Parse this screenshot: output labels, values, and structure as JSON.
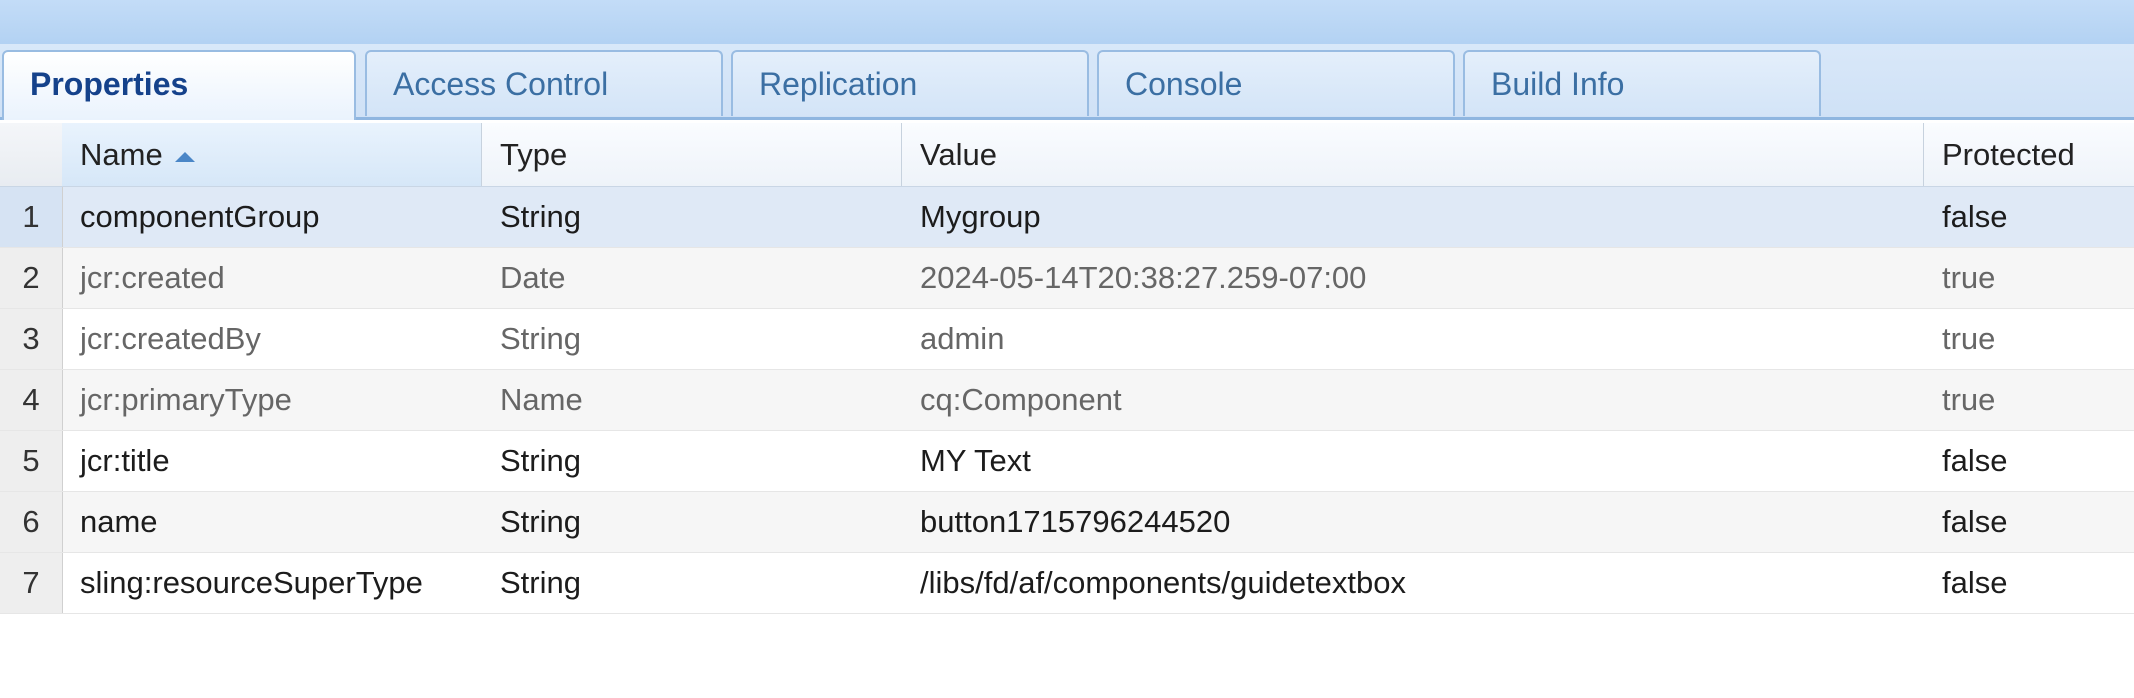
{
  "tabs": [
    {
      "label": "Properties",
      "active": true
    },
    {
      "label": "Access Control",
      "active": false
    },
    {
      "label": "Replication",
      "active": false
    },
    {
      "label": "Console",
      "active": false
    },
    {
      "label": "Build Info",
      "active": false
    }
  ],
  "table": {
    "columns": [
      "Name",
      "Type",
      "Value",
      "Protected"
    ],
    "sorted_column": "Name",
    "sort_direction": "ascending",
    "rows": [
      {
        "num": "1",
        "name": "componentGroup",
        "type": "String",
        "value": "Mygroup",
        "protected": "false"
      },
      {
        "num": "2",
        "name": "jcr:created",
        "type": "Date",
        "value": "2024-05-14T20:38:27.259-07:00",
        "protected": "true"
      },
      {
        "num": "3",
        "name": "jcr:createdBy",
        "type": "String",
        "value": "admin",
        "protected": "true"
      },
      {
        "num": "4",
        "name": "jcr:primaryType",
        "type": "Name",
        "value": "cq:Component",
        "protected": "true"
      },
      {
        "num": "5",
        "name": "jcr:title",
        "type": "String",
        "value": "MY Text",
        "protected": "false"
      },
      {
        "num": "6",
        "name": "name",
        "type": "String",
        "value": "button1715796244520",
        "protected": "false"
      },
      {
        "num": "7",
        "name": "sling:resourceSuperType",
        "type": "String",
        "value": "/libs/fd/af/components/guidetextbox",
        "protected": "false"
      }
    ]
  },
  "colors": {
    "accent": "#15428b",
    "selected_row": "#dfe9f6",
    "sort_arrow": "#4a86c7"
  }
}
